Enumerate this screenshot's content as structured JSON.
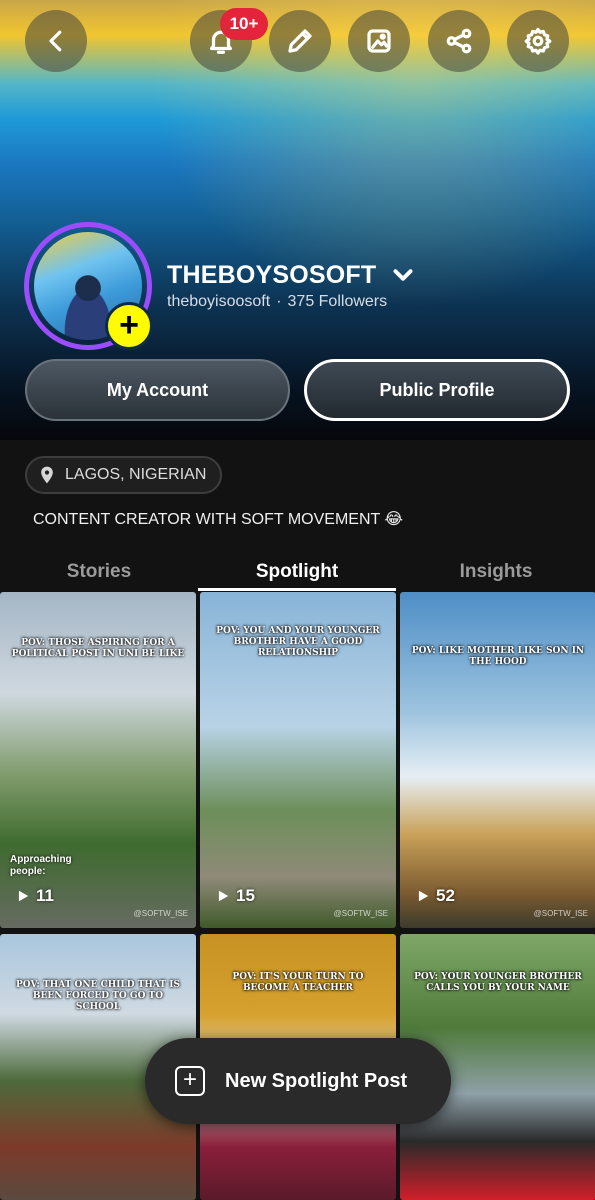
{
  "header": {
    "back_icon": "chevron-left-icon",
    "notifications_badge": "10+",
    "actions": [
      "bell-icon",
      "pencil-icon",
      "image-icon",
      "share-icon",
      "gear-icon"
    ]
  },
  "profile": {
    "display_name": "THEBOYSOSOFT",
    "username": "theboyisoosoft",
    "separator": "·",
    "followers": "375 Followers",
    "add_story_icon": "plus-icon"
  },
  "buttons": {
    "my_account": "My Account",
    "public_profile": "Public Profile"
  },
  "location": "LAGOS, NIGERIAN",
  "bio": "CONTENT CREATOR WITH SOFT MOVEMENT 😂",
  "tabs": [
    {
      "label": "Stories"
    },
    {
      "label": "Spotlight",
      "active": true
    },
    {
      "label": "Insights"
    }
  ],
  "spotlight_posts": [
    {
      "caption": "POV: THOSE ASPIRING FOR A POLITICAL POST IN UNI BE LIKE",
      "extra": "Approaching people:",
      "views": "11",
      "watermark": "@SOFTW_ISE"
    },
    {
      "caption": "POV: YOU AND YOUR YOUNGER BROTHER HAVE A GOOD RELATIONSHIP",
      "views": "15",
      "watermark": "@SOFTW_ISE"
    },
    {
      "caption": "POV: LIKE MOTHER LIKE SON IN THE HOOD",
      "views": "52",
      "watermark": "@SOFTW_ISE"
    },
    {
      "caption": "POV: THAT ONE CHILD THAT IS BEEN FORCED TO GO TO SCHOOL"
    },
    {
      "caption": "POV: IT'S YOUR TURN TO BECOME A TEACHER"
    },
    {
      "caption": "POV: YOUR YOUNGER BROTHER CALLS YOU BY YOUR NAME"
    }
  ],
  "fab": {
    "label": "New Spotlight Post"
  },
  "colors": {
    "accent_yellow": "#fffc00",
    "avatar_ring": "#9b4dff",
    "badge_red": "#e3243b"
  }
}
